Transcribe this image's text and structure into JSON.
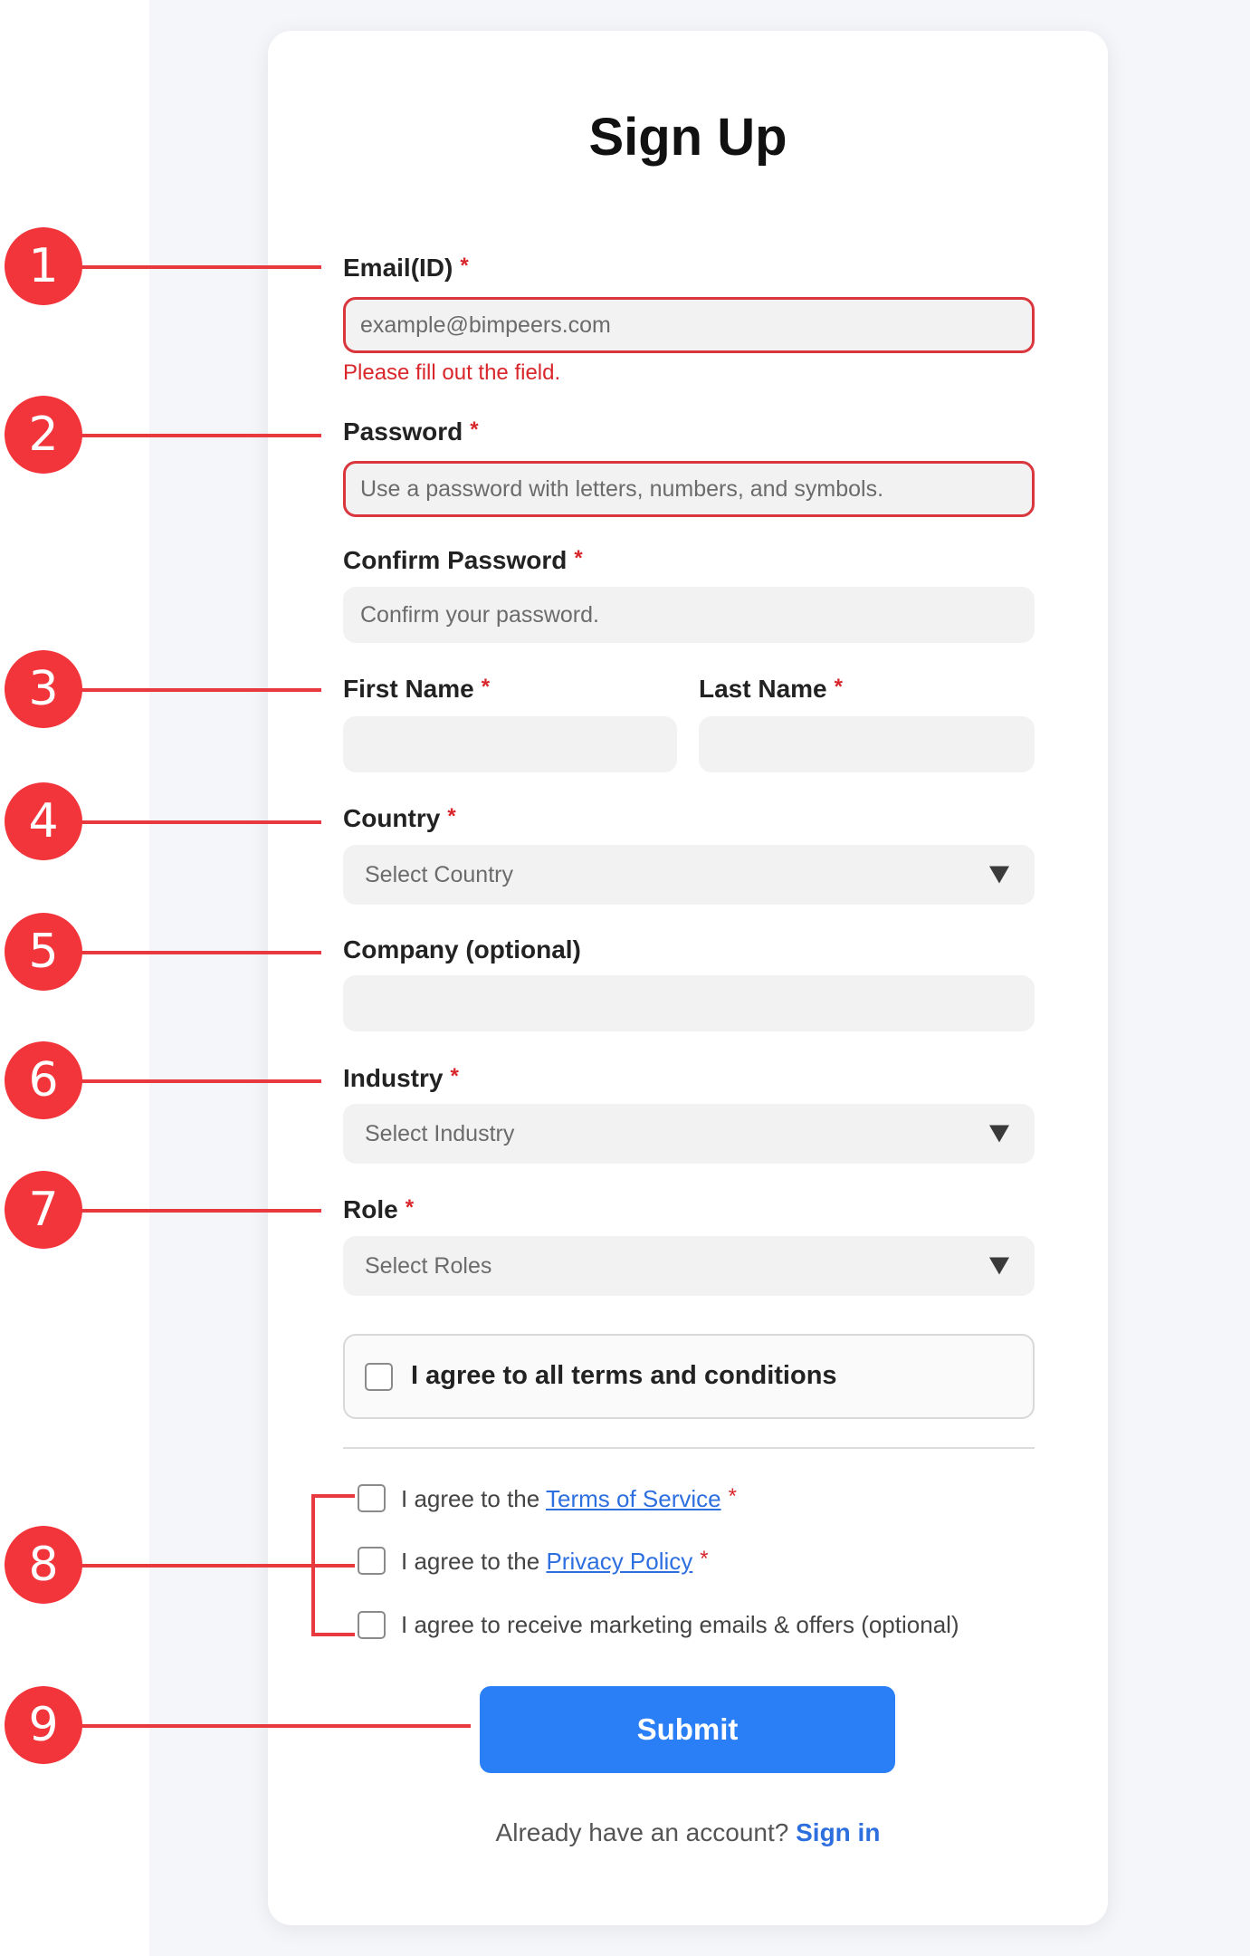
{
  "form": {
    "title": "Sign Up",
    "required_mark": "*",
    "email": {
      "label": "Email(ID)",
      "placeholder": "example@bimpeers.com",
      "error": "Please fill out the field."
    },
    "password": {
      "label": "Password",
      "placeholder": "Use a password with letters, numbers, and symbols."
    },
    "confirm_password": {
      "label": "Confirm Password",
      "placeholder": "Confirm your password."
    },
    "first_name": {
      "label": "First Name",
      "value": ""
    },
    "last_name": {
      "label": "Last Name",
      "value": ""
    },
    "country": {
      "label": "Country",
      "selected": "Select Country"
    },
    "company": {
      "label": "Company (optional)",
      "value": ""
    },
    "industry": {
      "label": "Industry",
      "selected": "Select Industry"
    },
    "role": {
      "label": "Role",
      "selected": "Select Roles"
    },
    "agree_all": "I agree to all terms and conditions",
    "terms": {
      "prefix": "I agree to the ",
      "link": "Terms of Service"
    },
    "privacy": {
      "prefix": "I agree to the ",
      "link": "Privacy Policy"
    },
    "marketing": "I agree to receive marketing emails & offers (optional)",
    "submit_label": "Submit",
    "signin_prompt": "Already have an account?",
    "signin_link": "Sign in"
  },
  "markers": [
    "1",
    "2",
    "3",
    "4",
    "5",
    "6",
    "7",
    "8",
    "9"
  ],
  "colors": {
    "accent": "#2a7ff6",
    "error": "#d9262b",
    "marker": "#f2353b",
    "link": "#2e6fe0"
  }
}
